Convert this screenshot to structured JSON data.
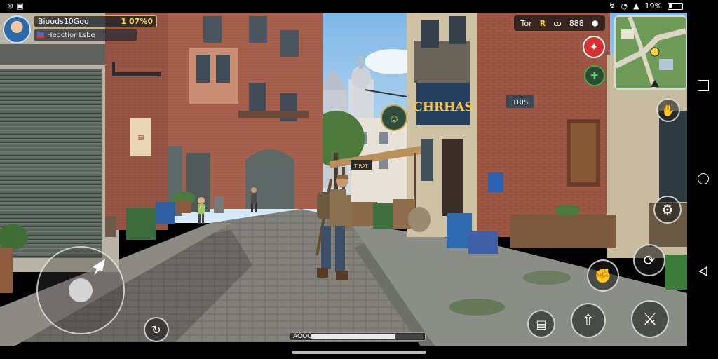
{
  "status_bar": {
    "battery_text": "19%"
  },
  "player": {
    "name": "Bioods10Goo",
    "score": "1 07%0",
    "subtitle": "Heoctior Lsbe",
    "avatar_icon": "player-avatar"
  },
  "toolbar": {
    "items": [
      "Tor",
      "R",
      "ꝏ",
      "888",
      "⬢"
    ]
  },
  "scene": {
    "shop_sign": "CHRHAS",
    "small_sign": "TRIS",
    "hanging_sign": "◎",
    "poster_text": "",
    "kiosk_sign": "TIRAT"
  },
  "stamina": {
    "label": "AOOO",
    "level": 0.75
  },
  "colors": {
    "hud_gold": "#ffd84a",
    "action_red": "#d63030",
    "action_green": "#3fae4a",
    "sky": "#a8d2f0"
  },
  "icons": {
    "action_buttons": [
      "skill-red-icon",
      "heal-green-icon",
      "interact-icon",
      "gear-icon",
      "reload-icon",
      "grab-icon",
      "jump-icon",
      "melee-icon",
      "inventory-icon",
      "sprint-icon"
    ]
  }
}
